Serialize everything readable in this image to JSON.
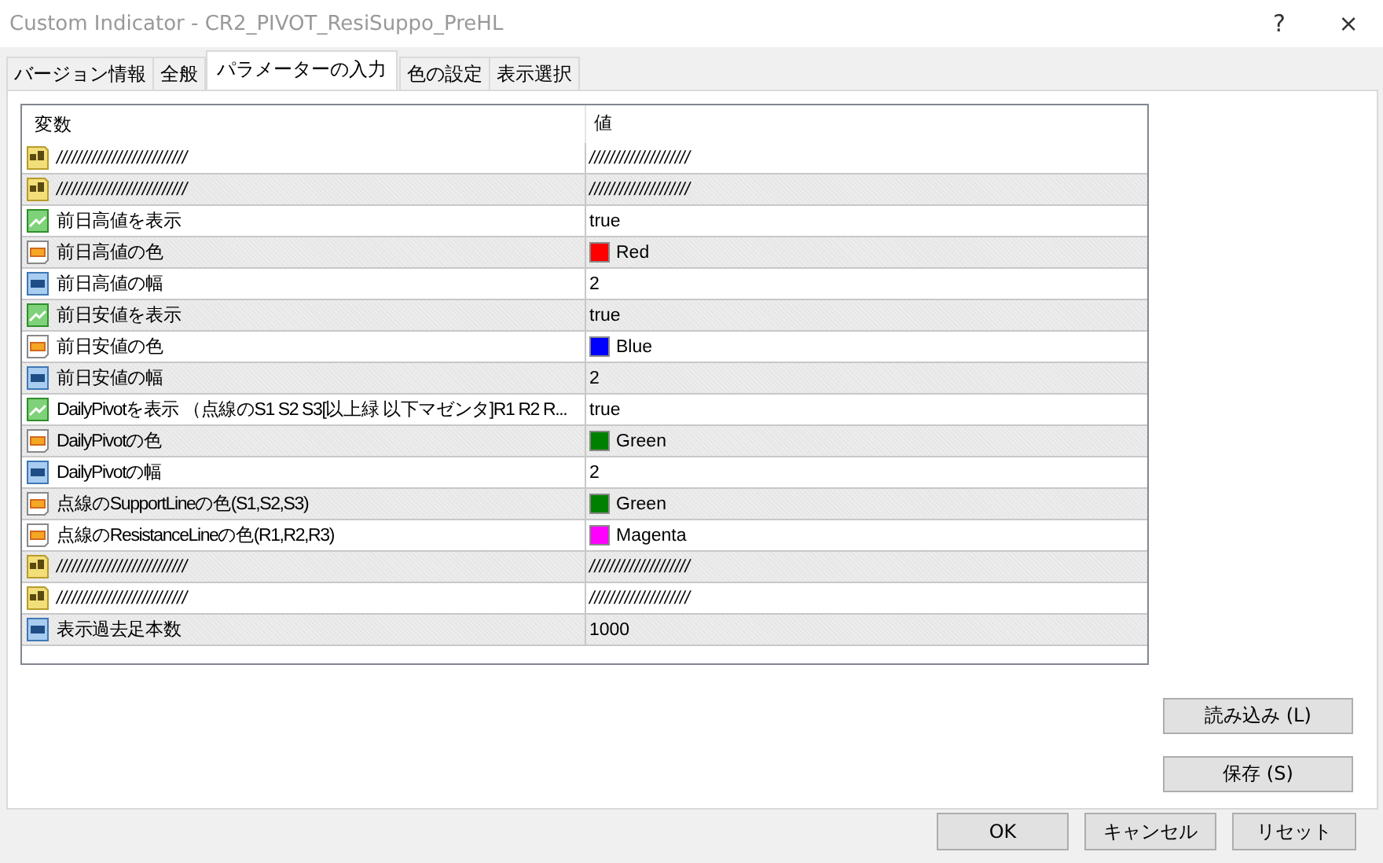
{
  "window": {
    "title": "Custom Indicator - CR2_PIVOT_ResiSuppo_PreHL",
    "help": "?",
    "close": "×"
  },
  "tabs": [
    {
      "label": "バージョン情報",
      "selected": false
    },
    {
      "label": "全般",
      "selected": false
    },
    {
      "label": "パラメーターの入力",
      "selected": true
    },
    {
      "label": "色の設定",
      "selected": false
    },
    {
      "label": "表示選択",
      "selected": false
    }
  ],
  "table": {
    "columns": [
      "変数",
      "値"
    ],
    "rows": [
      {
        "kind": "string",
        "name": "//////////////////////////",
        "value": "////////////////////"
      },
      {
        "kind": "string",
        "name": "//////////////////////////",
        "value": "////////////////////"
      },
      {
        "kind": "bool",
        "name": "前日高値を表示",
        "value": "true"
      },
      {
        "kind": "color",
        "name": "前日高値の色",
        "value": "Red",
        "color": "#ff0000"
      },
      {
        "kind": "int",
        "name": "前日高値の幅",
        "value": "2"
      },
      {
        "kind": "bool",
        "name": "前日安値を表示",
        "value": "true"
      },
      {
        "kind": "color",
        "name": "前日安値の色",
        "value": "Blue",
        "color": "#0000ff"
      },
      {
        "kind": "int",
        "name": "前日安値の幅",
        "value": "2"
      },
      {
        "kind": "bool",
        "name": "DailyPivotを表示 （点線のS1 S2 S3[以上緑 以下マゼンタ]R1 R2 R...",
        "value": "true"
      },
      {
        "kind": "color",
        "name": "DailyPivotの色",
        "value": "Green",
        "color": "#008000"
      },
      {
        "kind": "int",
        "name": "DailyPivotの幅",
        "value": "2"
      },
      {
        "kind": "color",
        "name": "点線のSupportLineの色(S1,S2,S3)",
        "value": "Green",
        "color": "#008000"
      },
      {
        "kind": "color",
        "name": "点線のResistanceLineの色(R1,R2,R3)",
        "value": "Magenta",
        "color": "#ff00ff"
      },
      {
        "kind": "string",
        "name": "//////////////////////////",
        "value": "////////////////////"
      },
      {
        "kind": "string",
        "name": "//////////////////////////",
        "value": "////////////////////"
      },
      {
        "kind": "int",
        "name": "表示過去足本数",
        "value": "1000"
      }
    ]
  },
  "side_buttons": [
    "読み込み (L)",
    "保存 (S)"
  ],
  "buttons": [
    "OK",
    "キャンセル",
    "リセット"
  ]
}
